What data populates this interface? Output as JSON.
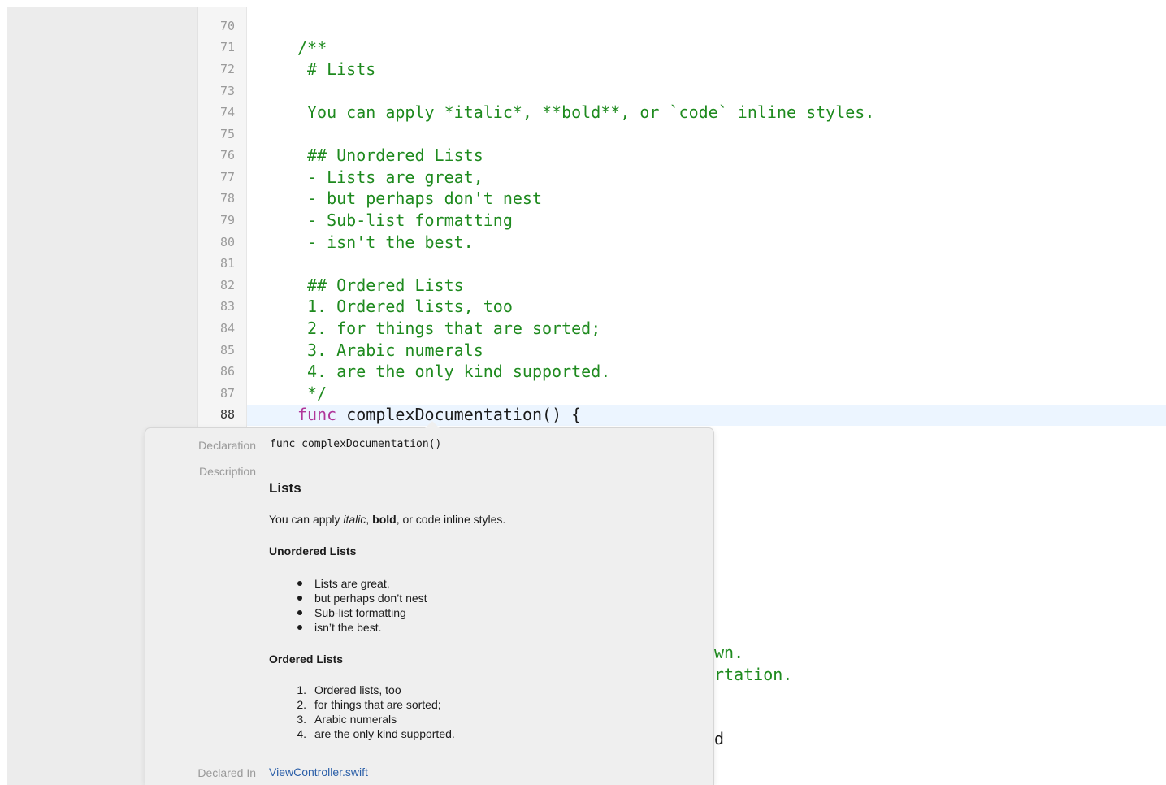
{
  "editor": {
    "line_numbers": [
      "70",
      "71",
      "72",
      "73",
      "74",
      "75",
      "76",
      "77",
      "78",
      "79",
      "80",
      "81",
      "82",
      "83",
      "84",
      "85",
      "86",
      "87",
      "88"
    ],
    "current_line": "88",
    "lines": {
      "l71": "/**",
      "l72": "# Lists",
      "l74": "You can apply *italic*, **bold**, or `code` inline styles.",
      "l76": "## Unordered Lists",
      "l77": "- Lists are great,",
      "l78": "- but perhaps don't nest",
      "l79": "- Sub-list formatting",
      "l80": "- isn't the best.",
      "l82": "## Ordered Lists",
      "l83": "1. Ordered lists, too",
      "l84": "2. for things that are sorted;",
      "l85": "3. Arabic numerals",
      "l86": "4. are the only kind supported.",
      "l87": "*/",
      "l88_keyword": "func",
      "l88_rest": "complexDocumentation() {"
    },
    "obscured_fragments": [
      "wn.",
      "rtation.",
      "d"
    ]
  },
  "quick_help": {
    "declaration_label": "Declaration",
    "declaration_value": "func complexDocumentation()",
    "description_label": "Description",
    "heading": "Lists",
    "inline_prefix": "You can apply ",
    "inline_italic": "italic",
    "inline_sep1": ", ",
    "inline_bold": "bold",
    "inline_suffix": ", or code inline styles.",
    "unordered_heading": "Unordered Lists",
    "unordered_items": [
      "Lists are great,",
      "but perhaps don’t nest",
      "Sub-list formatting",
      "isn’t the best."
    ],
    "ordered_heading": "Ordered Lists",
    "ordered_numbers": [
      "1.",
      "2.",
      "3.",
      "4."
    ],
    "ordered_items": [
      "Ordered lists, too",
      "for things that are sorted;",
      "Arabic numerals",
      "are the only kind supported."
    ],
    "declared_in_label": "Declared In",
    "declared_in_value": "ViewController.swift"
  },
  "colors": {
    "comment": "#1e8a1e",
    "keyword": "#b0369a",
    "link": "#2b5fa8",
    "current_line_highlight": "#ecf5ff"
  }
}
